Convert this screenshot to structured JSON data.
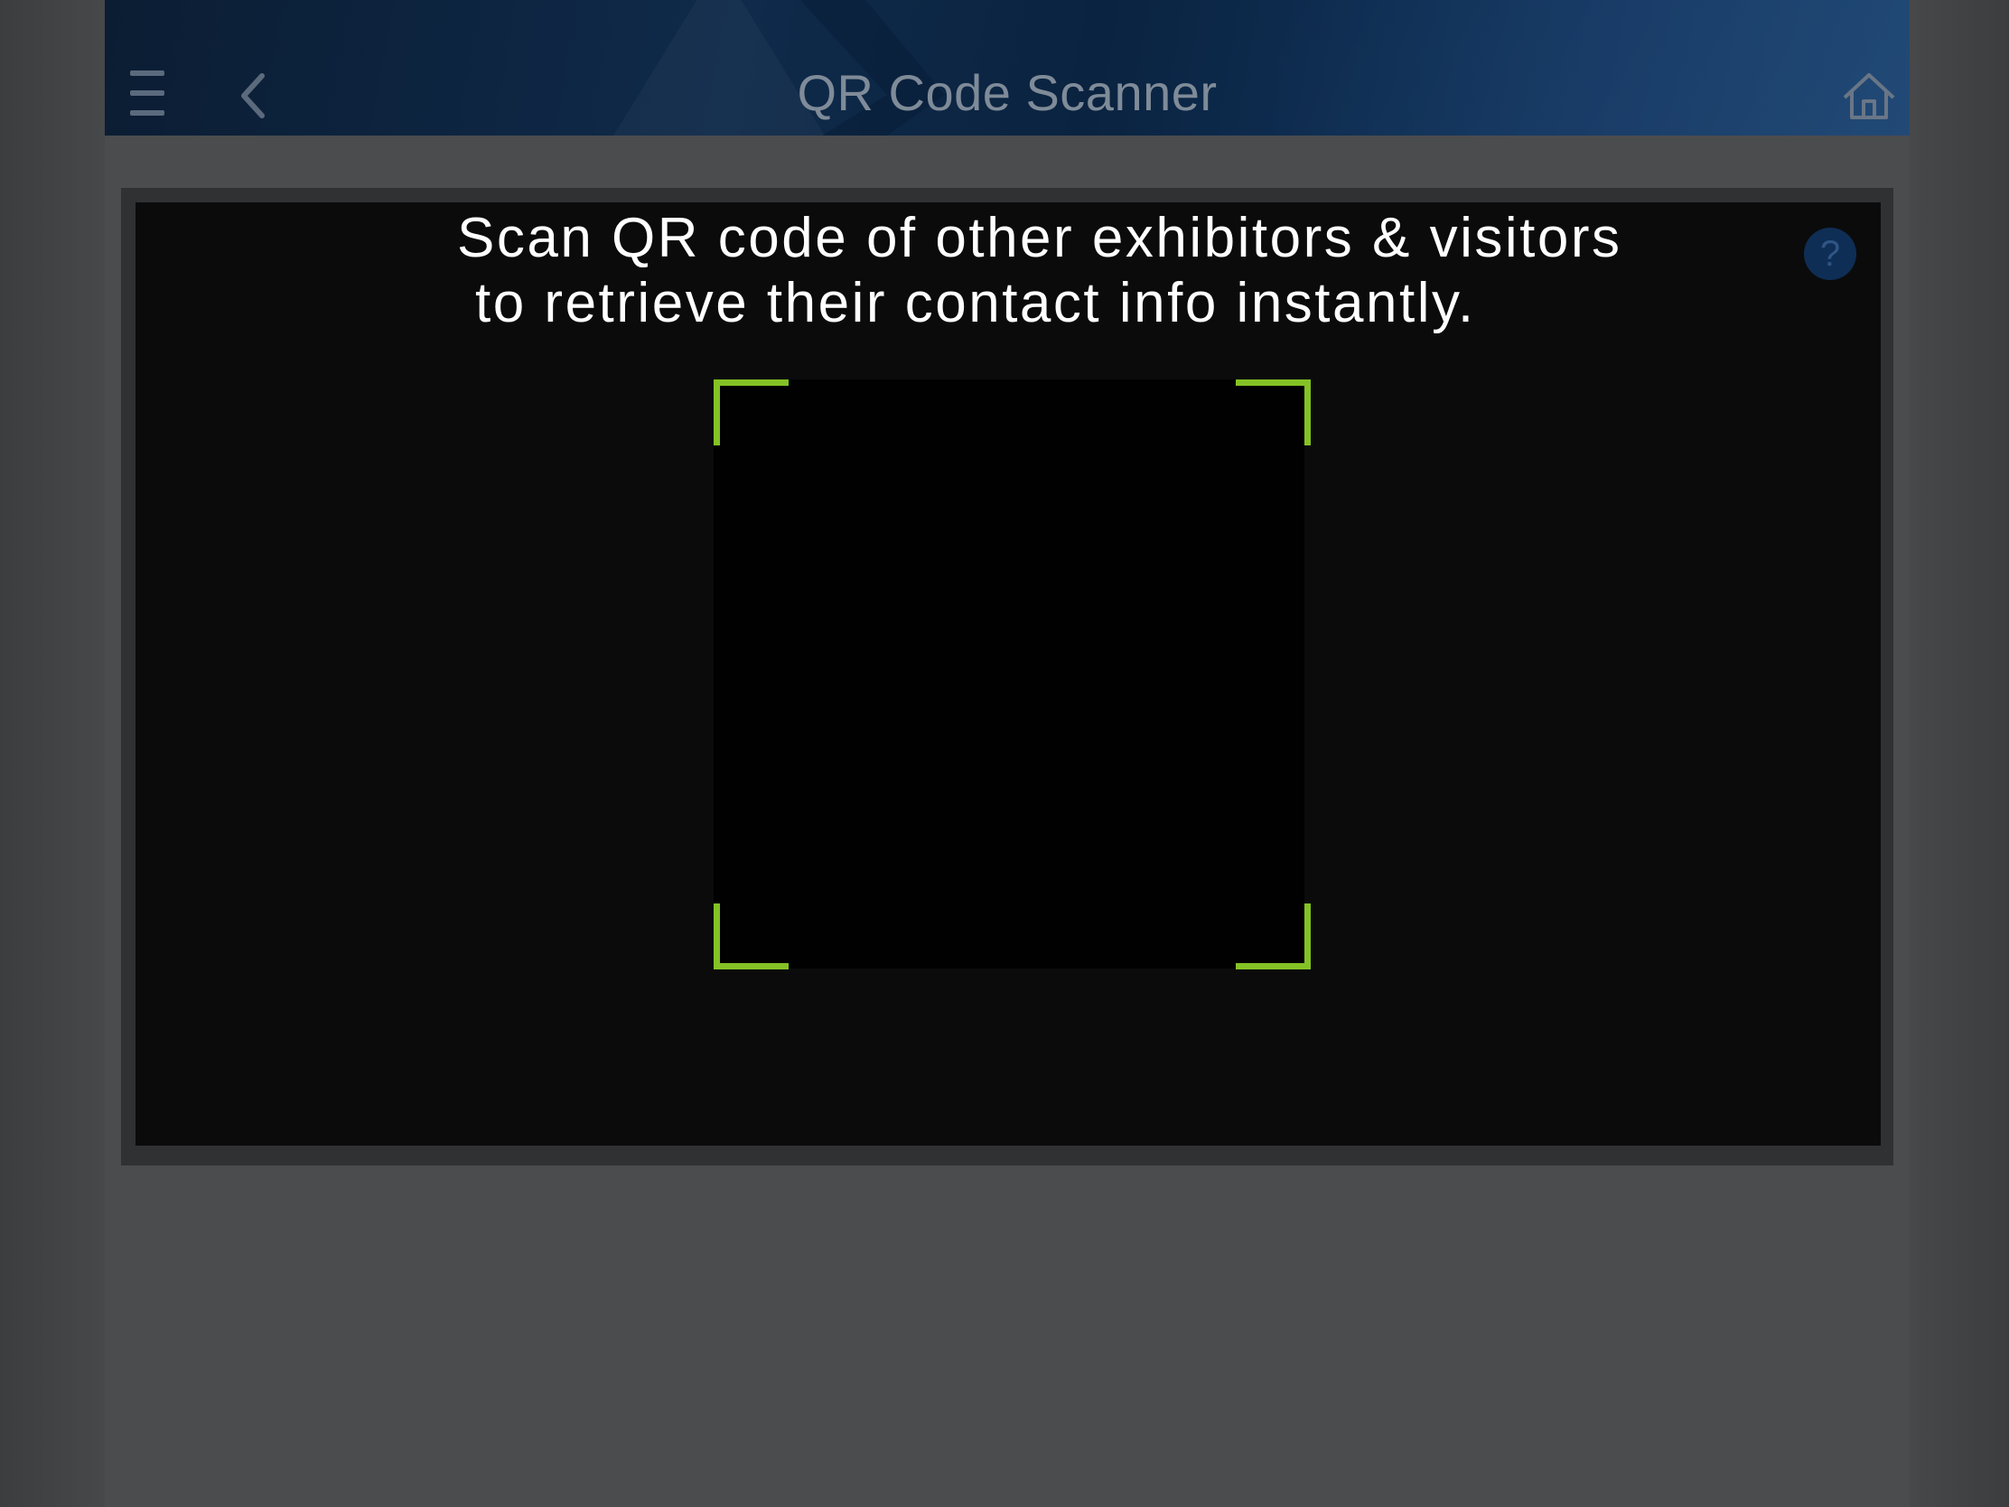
{
  "header": {
    "title": "QR Code Scanner",
    "menu_icon": "hamburger-menu-icon",
    "back_icon": "chevron-left-icon",
    "home_icon": "home-icon"
  },
  "scanner": {
    "instruction_line1": "Scan QR code of other exhibitors & visitors",
    "instruction_line2": "to retrieve their contact info instantly.",
    "help_label": "?",
    "frame_color": "#84c225"
  },
  "colors": {
    "header_bg": "#0f2a4a",
    "page_bg": "#4b4c4e",
    "help_bg": "#0f2e55"
  }
}
